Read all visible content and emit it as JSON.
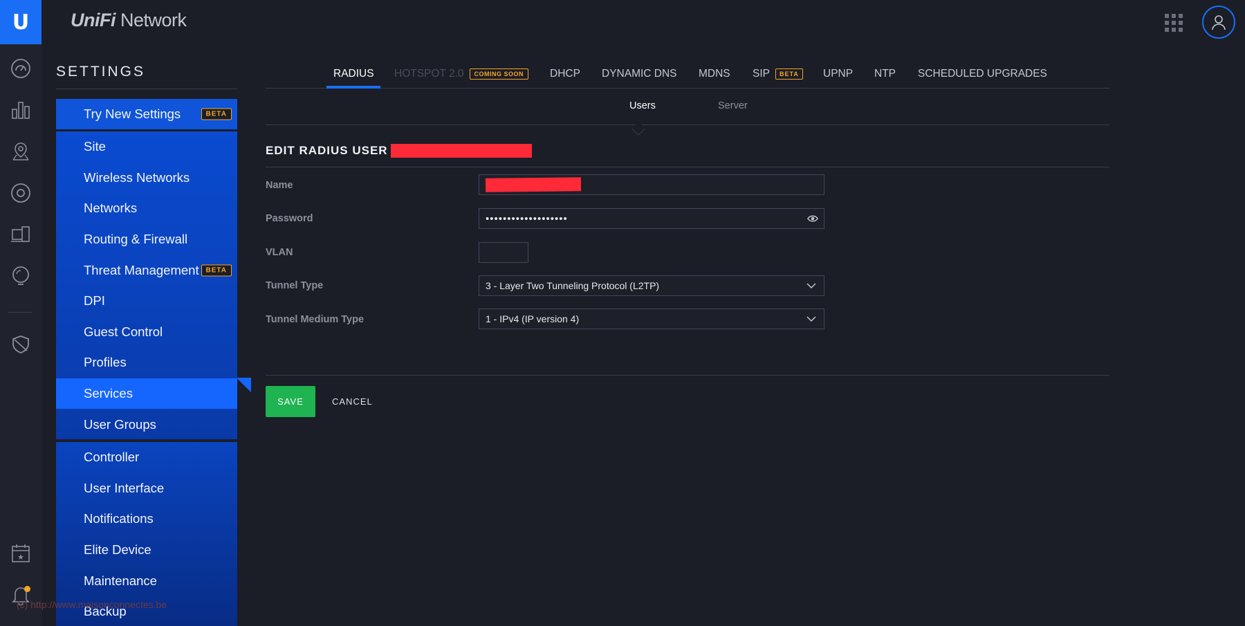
{
  "app": {
    "brand_unifi": "UniFi",
    "brand_network": "Network",
    "logo_letter": "U"
  },
  "sidebar": {
    "title": "SETTINGS",
    "try_new": {
      "label": "Try New Settings",
      "badge": "BETA"
    },
    "site_group": [
      {
        "label": "Site"
      },
      {
        "label": "Wireless Networks"
      },
      {
        "label": "Networks"
      },
      {
        "label": "Routing & Firewall"
      },
      {
        "label": "Threat Management",
        "badge": "BETA"
      },
      {
        "label": "DPI"
      },
      {
        "label": "Guest Control"
      },
      {
        "label": "Profiles"
      },
      {
        "label": "Services",
        "active": true
      },
      {
        "label": "User Groups"
      }
    ],
    "controller_group": [
      {
        "label": "Controller"
      },
      {
        "label": "User Interface"
      },
      {
        "label": "Notifications"
      },
      {
        "label": "Elite Device"
      },
      {
        "label": "Maintenance"
      },
      {
        "label": "Backup"
      }
    ]
  },
  "tabs": {
    "radius": "RADIUS",
    "hotspot": "HOTSPOT 2.0",
    "coming_soon": "COMING SOON",
    "dhcp": "DHCP",
    "ddns": "DYNAMIC DNS",
    "mdns": "MDNS",
    "sip": "SIP",
    "sip_badge": "BETA",
    "upnp": "UPNP",
    "ntp": "NTP",
    "scheduled": "SCHEDULED UPGRADES"
  },
  "subtabs": {
    "users": "Users",
    "server": "Server"
  },
  "form": {
    "title": "EDIT RADIUS USER",
    "name_label": "Name",
    "password_label": "Password",
    "password_value": "•••••••••••••••••••",
    "vlan_label": "VLAN",
    "vlan_value": "",
    "tunnel_type_label": "Tunnel Type",
    "tunnel_type_value": "3 - Layer Two Tunneling Protocol (L2TP)",
    "tunnel_medium_label": "Tunnel Medium Type",
    "tunnel_medium_value": "1 - IPv4 (IP version 4)",
    "save_label": "SAVE",
    "cancel_label": "CANCEL"
  },
  "watermark": "(c) http://www.maisonconnectes.be",
  "colors": {
    "accent": "#1a6ef5",
    "save": "#1fb352",
    "badge": "#f5a623",
    "redaction": "#ff2a38"
  }
}
